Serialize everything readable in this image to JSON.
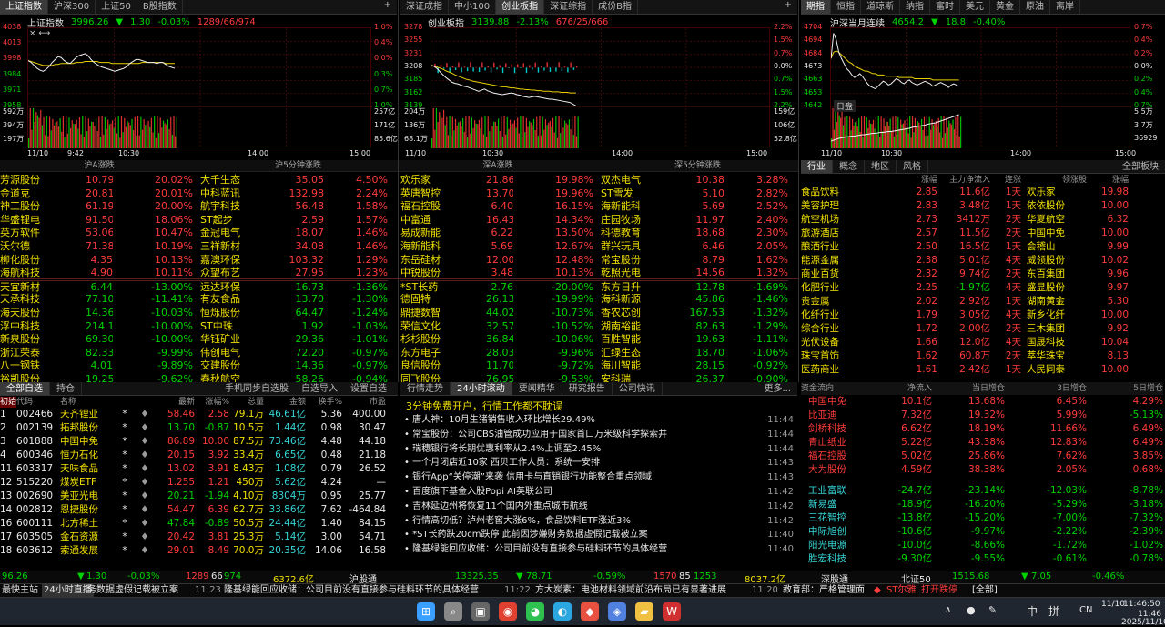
{
  "panelA": {
    "tabs": [
      "上证指数",
      "沪深300",
      "上证50",
      "B股指数"
    ],
    "name": "上证指数",
    "price": "3996.26",
    "chg": "1.30",
    "pct": "-0.03%",
    "breadth": "1289/66/974",
    "yl": [
      "4038",
      "4013",
      "3998",
      "3984",
      "3971",
      "3958"
    ],
    "yr": [
      "1.0%",
      "0.4%",
      "0.0%",
      "0.3%",
      "0.7%",
      "1.0%"
    ],
    "vl": [
      "592万",
      "394万",
      "197万"
    ],
    "vr": [
      "257亿",
      "171亿",
      "85.6亿"
    ],
    "xl": [
      "11/10",
      "9:42",
      "10:30",
      "14:00",
      "15:00"
    ],
    "price_series": [
      4005,
      4003,
      4000,
      3997,
      3995,
      3994,
      3996,
      3999,
      4003,
      4006,
      4009,
      4008,
      4005,
      4003,
      4002,
      4005,
      4008,
      4010,
      4011,
      4012,
      4010,
      4006,
      4003,
      4001,
      3999,
      3998,
      3997,
      3996,
      3995,
      3994,
      3995,
      3996,
      3997,
      3999,
      4002,
      4004,
      4006,
      4006,
      4005,
      4004,
      4003,
      4003,
      4003,
      4002,
      4003,
      4003,
      4001,
      3999,
      3998,
      3997
    ],
    "avg_series": [
      4005,
      4004,
      4003,
      4002,
      4001,
      4000,
      4000,
      4000,
      4000,
      4001,
      4001,
      4002,
      4002,
      4002,
      4002,
      4002,
      4003,
      4003,
      4003,
      4004,
      4004,
      4004,
      4004,
      4004,
      4003,
      4003,
      4003,
      4003,
      4002,
      4002,
      4002,
      4002,
      4002,
      4002,
      4002,
      4002,
      4002,
      4002,
      4003,
      4003,
      4003,
      4003,
      4003,
      4003,
      4003,
      4003,
      4002,
      4002,
      4002,
      4002
    ]
  },
  "panelB": {
    "tabs": [
      "深证成指",
      "中小100",
      "创业板指",
      "深证综指",
      "成份B指"
    ],
    "name": "创业板指",
    "price": "3139.88",
    "chg": "-2.13%",
    "breadth": "676/25/666",
    "yl": [
      "3278",
      "3255",
      "3231",
      "3208",
      "3185",
      "3162",
      "3139"
    ],
    "yr": [
      "2.2%",
      "1.5%",
      "0.7%",
      "0.0%",
      "0.7%",
      "1.5%",
      "2.2%"
    ],
    "vl": [
      "204万",
      "136万",
      "68.1万"
    ],
    "vr": [
      "159亿",
      "106亿",
      "52.8亿"
    ],
    "xl": [
      "11/10",
      "10:30",
      "14:00",
      "15:00"
    ],
    "price_series": [
      3212,
      3210,
      3206,
      3200,
      3195,
      3190,
      3186,
      3182,
      3180,
      3179,
      3177,
      3175,
      3174,
      3172,
      3170,
      3168,
      3166,
      3168,
      3170,
      3167,
      3165,
      3163,
      3162,
      3161,
      3160,
      3161,
      3162,
      3163,
      3162,
      3160,
      3159,
      3157,
      3156,
      3155,
      3156,
      3157,
      3156,
      3155,
      3154,
      3153,
      3152,
      3152,
      3151,
      3150,
      3149,
      3148,
      3147,
      3146,
      3143,
      3140
    ],
    "avg_series": [
      3212,
      3211,
      3209,
      3207,
      3205,
      3202,
      3200,
      3198,
      3195,
      3193,
      3191,
      3189,
      3187,
      3186,
      3184,
      3183,
      3182,
      3181,
      3180,
      3179,
      3178,
      3177,
      3176,
      3175,
      3174,
      3174,
      3173,
      3172,
      3172,
      3171,
      3170,
      3170,
      3169,
      3169,
      3168,
      3168,
      3167,
      3167,
      3166,
      3166,
      3166,
      3165,
      3165,
      3165,
      3164,
      3164,
      3164,
      3163,
      3163,
      3163
    ]
  },
  "panelC": {
    "tabs": [
      "期指",
      "恒指",
      "道琼斯",
      "纳指",
      "富时",
      "美元",
      "黄金",
      "原油",
      "离岸"
    ],
    "name": "沪深当月连续",
    "price": "4654.2",
    "chg": "18.8",
    "pct": "-0.40%",
    "yl": [
      "4704",
      "4694",
      "4684",
      "4673",
      "4663",
      "4653",
      "4642"
    ],
    "yr": [
      "0.7%",
      "0.4%",
      "0.2%",
      "0.0%",
      "0.2%",
      "0.4%",
      "0.7%"
    ],
    "sub": "日盘",
    "vr": [
      "5.5万",
      "3.7万",
      "36929"
    ],
    "xl": [
      "11/10",
      "10:30",
      "14:00",
      "15:00"
    ],
    "price_series": [
      4680,
      4700,
      4695,
      4685,
      4680,
      4676,
      4672,
      4670,
      4667,
      4665,
      4666,
      4668,
      4666,
      4663,
      4660,
      4658,
      4657,
      4656,
      4658,
      4660,
      4662,
      4661,
      4659,
      4660,
      4662,
      4664,
      4663,
      4661,
      4660,
      4662,
      4663,
      4661,
      4660,
      4659,
      4660,
      4661,
      4662,
      4661,
      4660,
      4658,
      4659,
      4660,
      4661,
      4660,
      4659,
      4657,
      4659,
      4660,
      4659,
      4658
    ],
    "avg_series": [
      4680,
      4685,
      4686,
      4685,
      4683,
      4681,
      4679,
      4677,
      4676,
      4674,
      4673,
      4672,
      4671,
      4670,
      4670,
      4669,
      4668,
      4668,
      4667,
      4667,
      4667,
      4666,
      4666,
      4666,
      4666,
      4666,
      4665,
      4665,
      4665,
      4665,
      4665,
      4665,
      4664,
      4664,
      4664,
      4664,
      4664,
      4664,
      4664,
      4663,
      4663,
      4663,
      4663,
      4663,
      4663,
      4663,
      4663,
      4663,
      4663,
      4663
    ],
    "oi_series": [
      10,
      12,
      14,
      16,
      17,
      18,
      19,
      20,
      21,
      21,
      22,
      23,
      24,
      24,
      25,
      26,
      27,
      27,
      28,
      29,
      29,
      30,
      31,
      31,
      32,
      33,
      34,
      35,
      36,
      37,
      38,
      40,
      41,
      42,
      43,
      44,
      45,
      47,
      48,
      49,
      50,
      52,
      54,
      56,
      58,
      60,
      62,
      64,
      66,
      68
    ]
  },
  "rank1": {
    "h1": "沪A涨跌",
    "h2": "沪5分钟涨跌",
    "gain": [
      [
        "芳源股份",
        "10.79",
        "20.02%",
        "大千生态",
        "35.05",
        "4.50%"
      ],
      [
        "金道克",
        "20.81",
        "20.01%",
        "中科蓝讯",
        "132.98",
        "2.24%"
      ],
      [
        "神工股份",
        "61.19",
        "20.00%",
        "航宇科技",
        "56.48",
        "1.58%"
      ],
      [
        "华盛锂电",
        "91.50",
        "18.06%",
        "ST起步",
        "2.59",
        "1.57%"
      ],
      [
        "英方软件",
        "53.06",
        "10.47%",
        "金冠电气",
        "18.07",
        "1.46%"
      ],
      [
        "沃尔德",
        "71.38",
        "10.19%",
        "三祥新材",
        "34.08",
        "1.46%"
      ],
      [
        "柳化股份",
        "4.35",
        "10.13%",
        "嘉澳环保",
        "103.32",
        "1.29%"
      ],
      [
        "海航科技",
        "4.90",
        "10.11%",
        "众望布艺",
        "27.95",
        "1.23%"
      ]
    ],
    "loss": [
      [
        "天宜新材",
        "6.44",
        "-13.00%",
        "远达环保",
        "16.73",
        "-1.36%"
      ],
      [
        "天承科技",
        "77.10",
        "-11.41%",
        "有友食品",
        "13.70",
        "-1.30%"
      ],
      [
        "海天股份",
        "14.36",
        "-10.03%",
        "恒烁股份",
        "64.47",
        "-1.24%"
      ],
      [
        "浮中科技",
        "214.18",
        "-10.00%",
        "ST中珠",
        "1.92",
        "-1.03%"
      ],
      [
        "新泉股份",
        "69.30",
        "-10.00%",
        "华钰矿业",
        "29.36",
        "-1.01%"
      ],
      [
        "浙江荣泰",
        "82.33",
        "-9.99%",
        "伟创电气",
        "72.20",
        "-0.97%"
      ],
      [
        "八一钢铁",
        "4.01",
        "-9.89%",
        "交建股份",
        "14.36",
        "-0.97%"
      ],
      [
        "裕凯股份",
        "19.25",
        "-9.62%",
        "春秋航空",
        "58.26",
        "-0.94%"
      ]
    ]
  },
  "rank2": {
    "h1": "深A涨跌",
    "h2": "深5分钟涨跌",
    "gain": [
      [
        "欢乐家",
        "21.86",
        "19.98%",
        "双杰电气",
        "10.38",
        "3.28%"
      ],
      [
        "英唐智控",
        "13.70",
        "19.96%",
        "ST雪发",
        "5.10",
        "2.82%"
      ],
      [
        "福石控股",
        "6.40",
        "16.15%",
        "海新能科",
        "5.69",
        "2.52%"
      ],
      [
        "中富通",
        "16.43",
        "14.34%",
        "庄园牧场",
        "11.97",
        "2.40%"
      ],
      [
        "易成新能",
        "6.22",
        "13.50%",
        "科德教育",
        "18.68",
        "2.30%"
      ],
      [
        "海新能科",
        "5.69",
        "12.67%",
        "群兴玩具",
        "6.46",
        "2.05%"
      ],
      [
        "东岳硅材",
        "12.00",
        "12.48%",
        "常宝股份",
        "8.79",
        "1.62%"
      ],
      [
        "中锐股份",
        "3.48",
        "10.13%",
        "乾照光电",
        "14.56",
        "1.32%"
      ]
    ],
    "loss": [
      [
        "*ST长药",
        "2.76",
        "-20.00%",
        "东方日升",
        "12.78",
        "-1.69%"
      ],
      [
        "德固特",
        "26.13",
        "-19.99%",
        "海科新源",
        "45.86",
        "-1.46%"
      ],
      [
        "鼎捷数智",
        "44.02",
        "-10.73%",
        "香农芯创",
        "167.53",
        "-1.32%"
      ],
      [
        "荣信文化",
        "32.57",
        "-10.52%",
        "湖南裕能",
        "82.63",
        "-1.29%"
      ],
      [
        "杉杉股份",
        "36.84",
        "-10.06%",
        "百胜智能",
        "19.63",
        "-1.11%"
      ],
      [
        "东方电子",
        "28.03",
        "-9.96%",
        "汇绿生态",
        "18.70",
        "-1.06%"
      ],
      [
        "良信股份",
        "11.70",
        "-9.72%",
        "海川智能",
        "28.15",
        "-0.92%"
      ],
      [
        "同飞股份",
        "76.95",
        "-9.53%",
        "安科瑞",
        "26.37",
        "-0.90%"
      ]
    ]
  },
  "sector": {
    "tabs": [
      "行业",
      "概念",
      "地区",
      "风格"
    ],
    "btn": "全部板块",
    "heads": [
      "",
      "涨幅",
      "主力净流入",
      "连涨",
      "领涨股",
      "涨幅"
    ],
    "rows": [
      [
        "食品饮料",
        "2.85",
        "11.6亿",
        "1天",
        "欢乐家",
        "19.98"
      ],
      [
        "美容护理",
        "2.83",
        "3.48亿",
        "1天",
        "依依股份",
        "10.00"
      ],
      [
        "航空机场",
        "2.73",
        "3412万",
        "2天",
        "华夏航空",
        "6.32"
      ],
      [
        "旅游酒店",
        "2.57",
        "11.5亿",
        "2天",
        "中国中免",
        "10.00"
      ],
      [
        "酿酒行业",
        "2.50",
        "16.5亿",
        "1天",
        "会稽山",
        "9.99"
      ],
      [
        "能源金属",
        "2.38",
        "5.01亿",
        "4天",
        "威领股份",
        "10.02"
      ],
      [
        "商业百货",
        "2.32",
        "9.74亿",
        "2天",
        "东百集团",
        "9.96"
      ],
      [
        "化肥行业",
        "2.25",
        "-1.97亿",
        "4天",
        "盛显股份",
        "9.97"
      ],
      [
        "贵金属",
        "2.02",
        "2.92亿",
        "1天",
        "湖南黄金",
        "5.30"
      ],
      [
        "化纤行业",
        "1.79",
        "3.05亿",
        "4天",
        "新乡化纤",
        "10.00"
      ],
      [
        "综合行业",
        "1.72",
        "2.00亿",
        "2天",
        "三木集团",
        "9.92"
      ],
      [
        "光伏设备",
        "1.66",
        "12.0亿",
        "4天",
        "国晟科技",
        "10.04"
      ],
      [
        "珠宝首饰",
        "1.62",
        "60.8万",
        "2天",
        "萃华珠宝",
        "8.13"
      ],
      [
        "医药商业",
        "1.61",
        "2.42亿",
        "1天",
        "人民同泰",
        "10.00"
      ]
    ]
  },
  "watch": {
    "tabs": [
      "全部自选",
      "持仓"
    ],
    "links": [
      "手机同步自选股",
      "自选导入",
      "设置自选"
    ],
    "heads": [
      "",
      "代码",
      "名称",
      "",
      "",
      "最新",
      "涨幅%",
      "总量",
      "金额",
      "换手%",
      "市盈"
    ],
    "tag": "初始",
    "rows": [
      [
        "1",
        "002466",
        "天齐锂业",
        "58.46",
        "2.58",
        "79.1万",
        "46.61亿",
        "5.36",
        "400.00"
      ],
      [
        "2",
        "002139",
        "拓邦股份",
        "13.70",
        "-0.87",
        "10.5万",
        "1.44亿",
        "0.98",
        "30.47"
      ],
      [
        "3",
        "601888",
        "中国中免",
        "86.89",
        "10.00",
        "87.5万",
        "73.46亿",
        "4.48",
        "44.18"
      ],
      [
        "4",
        "600346",
        "恒力石化",
        "20.15",
        "3.92",
        "33.4万",
        "6.65亿",
        "0.48",
        "21.18"
      ],
      [
        "11",
        "603317",
        "天味食品",
        "13.02",
        "3.91",
        "8.43万",
        "1.08亿",
        "0.79",
        "26.52"
      ],
      [
        "12",
        "515220",
        "煤炭ETF",
        "1.255",
        "1.21",
        "450万",
        "5.62亿",
        "4.24",
        "—"
      ],
      [
        "13",
        "002690",
        "美亚光电",
        "20.21",
        "-1.94",
        "4.10万",
        "8304万",
        "0.95",
        "25.77"
      ],
      [
        "14",
        "002812",
        "恩捷股份",
        "54.47",
        "6.39",
        "62.7万",
        "33.86亿",
        "7.62",
        "-464.84"
      ],
      [
        "16",
        "600111",
        "北方稀土",
        "47.84",
        "-0.89",
        "50.5万",
        "24.44亿",
        "1.40",
        "84.15"
      ],
      [
        "17",
        "603505",
        "金石资源",
        "20.42",
        "3.81",
        "25.3万",
        "5.14亿",
        "3.00",
        "54.71"
      ],
      [
        "18",
        "603612",
        "索通发展",
        "29.01",
        "8.49",
        "70.0万",
        "20.35亿",
        "14.06",
        "16.58"
      ]
    ]
  },
  "news": {
    "tabs": [
      "行情走势",
      "24小时滚动",
      "要闻精华",
      "研究报告",
      "公司快讯"
    ],
    "more": "更多...",
    "headline": "3分钟免费开户，行情工作都不耽误",
    "rows": [
      [
        "唐人神：10月生猪销售收入环比增长29.49%",
        "11:44"
      ],
      [
        "常宝股份：公司CBS油管成功应用于国家首口万米级科学探索井",
        "11:44"
      ],
      [
        "瑞穗银行将长期优惠利率从2.4%上调至2.45%",
        "11:44"
      ],
      [
        "一个月闭店近10家 西贝工作人员：系统一安排",
        "11:43"
      ],
      [
        "银行App“关停潮”来袭 信用卡与直销银行功能整合重点领域",
        "11:43"
      ],
      [
        "百度旗下基金入股Popi AI英联公司",
        "11:42"
      ],
      [
        "吉林延边州将恢复11个国内外重点城市航线",
        "11:42"
      ],
      [
        "行情高切低？泸州老窖大涨6%，食品饮料ETF涨近3%",
        "11:42"
      ],
      [
        "*ST长药跌20cm跌停 此前因涉嫌财务数据虚假记载被立案",
        "11:40"
      ],
      [
        "隆基绿能回应收储：公司目前没有直接参与硅料环节的具体经营",
        "11:40"
      ]
    ]
  },
  "flow": {
    "heads": [
      "资金流向",
      "净流入",
      "当日增仓",
      "3日增仓",
      "5日增仓"
    ],
    "inflow": [
      [
        "中国中免",
        "10.1亿",
        "13.68%",
        "6.45%",
        "4.29%"
      ],
      [
        "比亚迪",
        "7.32亿",
        "19.32%",
        "5.99%",
        "-5.13%"
      ],
      [
        "剑桥科技",
        "6.62亿",
        "18.19%",
        "11.66%",
        "6.49%"
      ],
      [
        "青山纸业",
        "5.22亿",
        "43.38%",
        "12.83%",
        "6.49%"
      ],
      [
        "福石控股",
        "5.02亿",
        "25.86%",
        "7.62%",
        "3.85%"
      ],
      [
        "大为股份",
        "4.59亿",
        "38.38%",
        "2.05%",
        "0.68%"
      ]
    ],
    "outflow": [
      [
        "工业富联",
        "-24.7亿",
        "-23.14%",
        "-12.03%",
        "-8.78%"
      ],
      [
        "新易盛",
        "-18.9亿",
        "-16.20%",
        "-5.29%",
        "-3.18%"
      ],
      [
        "三花智控",
        "-13.8亿",
        "-15.20%",
        "-7.00%",
        "-7.32%"
      ],
      [
        "中际旭创",
        "-10.6亿",
        "-9.97%",
        "-2.22%",
        "-2.39%"
      ],
      [
        "阳光电源",
        "-10.0亿",
        "-8.66%",
        "-1.72%",
        "-1.02%"
      ],
      [
        "胜宏科技",
        "-9.30亿",
        "-9.55%",
        "-0.61%",
        "-0.78%"
      ]
    ]
  },
  "status": {
    "a": "96.26",
    "b": "1.30",
    "c": "-0.03%",
    "d": "1289",
    "e": "66",
    "f": "974",
    "g": "6372.6亿",
    "h": "沪股通",
    "i": "13325.35",
    "j": "78.71",
    "k": "-0.59%",
    "l": "1570",
    "m": "85",
    "n": "1253",
    "o": "8037.2亿",
    "p": "深股通",
    "q": "北证50",
    "r": "1515.68",
    "s": "7.05",
    "t": "-0.46%"
  },
  "ticker": {
    "a": "最快主站",
    "b": "24小时直播",
    "c": "务数据虚假记载被立案",
    "t1": "11:23",
    "d": "隆基绿能回应收储：公司目前没有直接参与硅料环节的具体经营",
    "t2": "11:22",
    "e": "方大炭素：电池材料领域前沿布局已有显著进展",
    "t3": "11:20",
    "f": "教育部：严格管理面",
    "g": "ST尔雅",
    "h": "打开跌停",
    "i": "[全部]"
  },
  "taskbar": {
    "lang1": "中",
    "lang2": "拼",
    "cn": "CN",
    "date": "11/10",
    "time": "11:46:50",
    "clock": "11:46",
    "fulldate": "2025/11/10",
    "apps": [
      "start",
      "search",
      "taskview",
      "chrome",
      "wechat",
      "edge",
      "app1",
      "app2",
      "folder",
      "wps"
    ]
  }
}
